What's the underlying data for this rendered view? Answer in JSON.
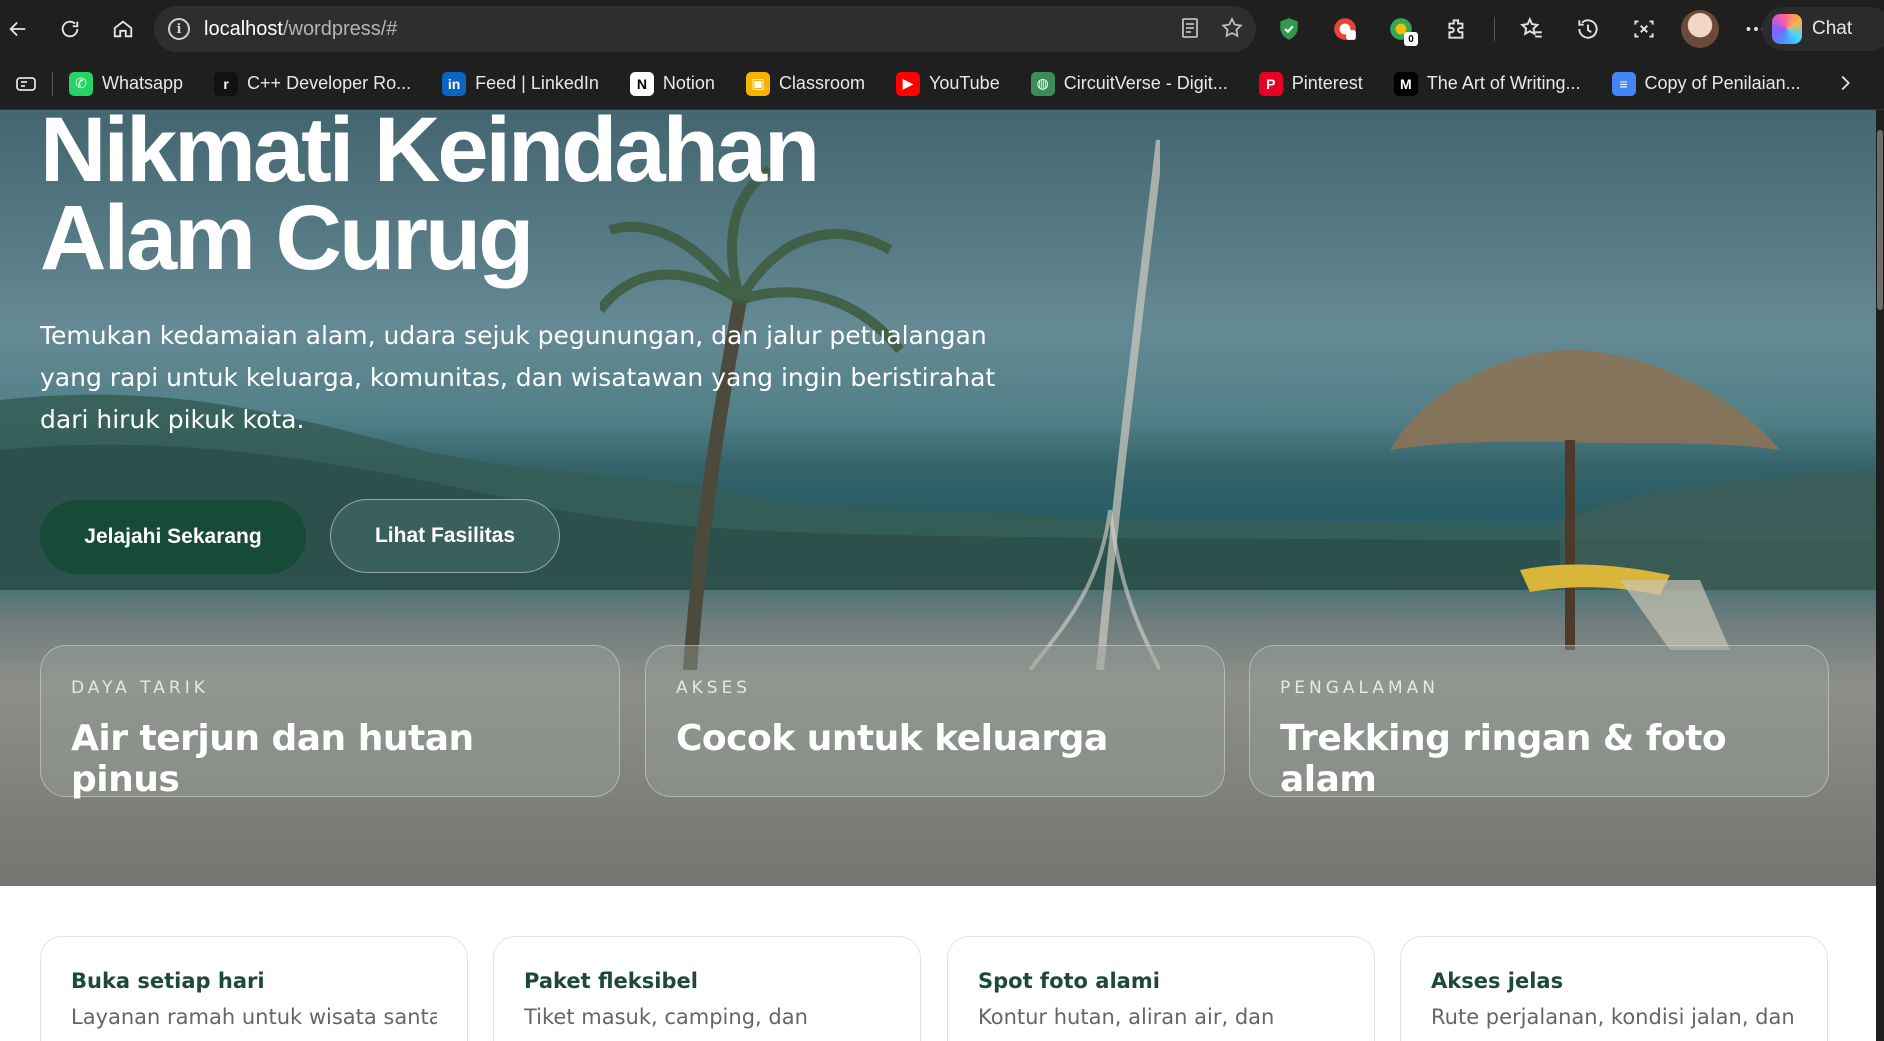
{
  "browser": {
    "url_host": "localhost",
    "url_path": "/wordpress/#",
    "chat_label": "Chat",
    "extension_badge": "0"
  },
  "bookmarks": [
    {
      "label": "Whatsapp",
      "icon": "whatsapp-icon",
      "color": "#25d366"
    },
    {
      "label": "C++ Developer Ro...",
      "icon": "roadmap-icon",
      "color": "#111111"
    },
    {
      "label": "Feed | LinkedIn",
      "icon": "linkedin-icon",
      "color": "#0a66c2"
    },
    {
      "label": "Notion",
      "icon": "notion-icon",
      "color": "#ffffff"
    },
    {
      "label": "Classroom",
      "icon": "classroom-icon",
      "color": "#f4b400"
    },
    {
      "label": "YouTube",
      "icon": "youtube-icon",
      "color": "#ff0000"
    },
    {
      "label": "CircuitVerse - Digit...",
      "icon": "circuitverse-icon",
      "color": "#3c8c5a"
    },
    {
      "label": "Pinterest",
      "icon": "pinterest-icon",
      "color": "#e60023"
    },
    {
      "label": "The Art of Writing...",
      "icon": "medium-icon",
      "color": "#000000"
    },
    {
      "label": "Copy of Penilaian...",
      "icon": "docs-icon",
      "color": "#4285f4"
    }
  ],
  "hero": {
    "title_line1": "Nikmati Keindahan",
    "title_line2": "Alam Curug",
    "subtitle": "Temukan kedamaian alam, udara sejuk pegunungan, dan jalur petualangan yang rapi untuk keluarga, komunitas, dan wisatawan yang ingin beristirahat dari hiruk pikuk kota.",
    "primary_cta": "Jelajahi Sekarang",
    "secondary_cta": "Lihat Fasilitas"
  },
  "features": [
    {
      "label": "DAYA TARIK",
      "value": "Air terjun dan hutan pinus"
    },
    {
      "label": "AKSES",
      "value": "Cocok untuk keluarga"
    },
    {
      "label": "PENGALAMAN",
      "value": "Trekking ringan & foto alam"
    }
  ],
  "cards": [
    {
      "title": "Buka setiap hari",
      "desc": "Layanan ramah untuk wisata santai"
    },
    {
      "title": "Paket fleksibel",
      "desc": "Tiket masuk, camping, dan"
    },
    {
      "title": "Spot foto alami",
      "desc": "Kontur hutan, aliran air, dan"
    },
    {
      "title": "Akses jelas",
      "desc": "Rute perjalanan, kondisi jalan, dan"
    }
  ],
  "colors": {
    "brand_green": "#174a37",
    "card_title": "#1d4a38"
  }
}
